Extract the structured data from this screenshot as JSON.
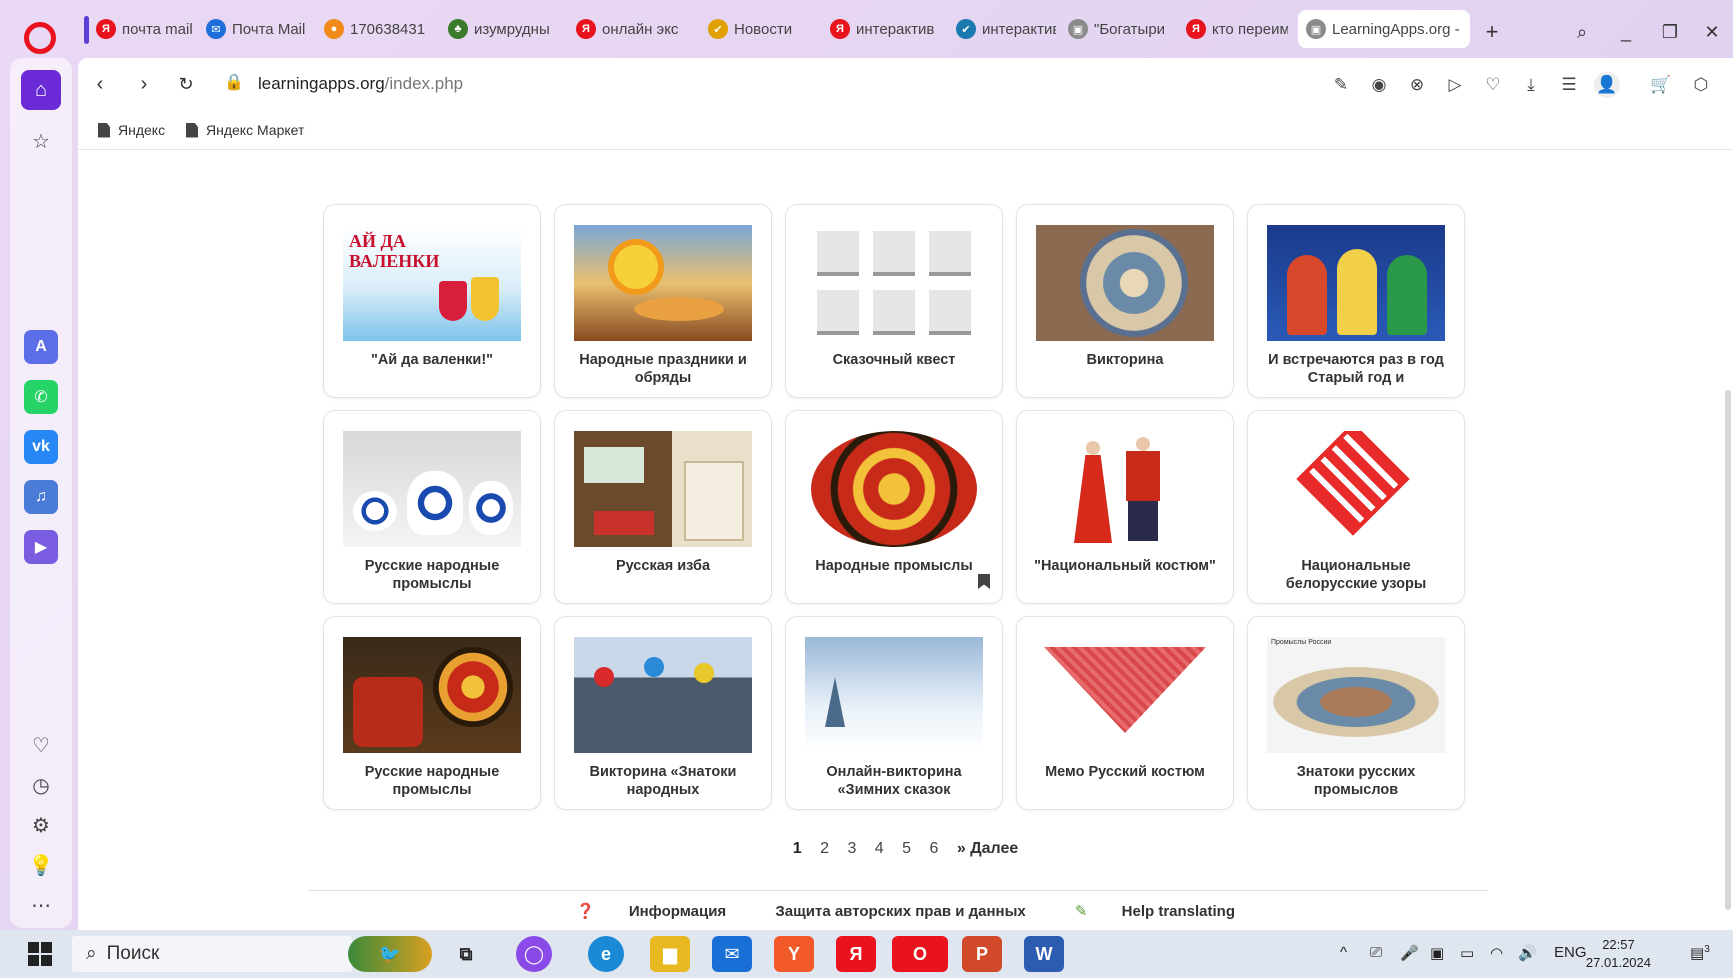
{
  "tabs": [
    {
      "label": "почта mail",
      "fav": "Я",
      "color": "#e8131d"
    },
    {
      "label": "Почта Mail",
      "fav": "✉",
      "color": "#1e6fd9"
    },
    {
      "label": "170638431",
      "fav": "●",
      "color": "#f28a1a"
    },
    {
      "label": "изумрудны",
      "fav": "♣",
      "color": "#3a7a2a"
    },
    {
      "label": "онлайн экс",
      "fav": "Я",
      "color": "#e8131d"
    },
    {
      "label": "Новости",
      "fav": "✔",
      "color": "#e0a000"
    },
    {
      "label": "интерактив",
      "fav": "Я",
      "color": "#e8131d"
    },
    {
      "label": "интерактив",
      "fav": "✔",
      "color": "#1a7ab0"
    },
    {
      "label": "\"Богатыри",
      "fav": "▣",
      "color": "#8a8a8a"
    },
    {
      "label": "кто переим",
      "fav": "Я",
      "color": "#e8131d"
    },
    {
      "label": "LearningApps.org -",
      "fav": "▣",
      "color": "#8a8a8a"
    }
  ],
  "address": {
    "host": "learningapps.org",
    "path": "/index.php"
  },
  "bookmarks": [
    "Яндекс",
    "Яндекс Маркет"
  ],
  "cards": [
    {
      "title": "\"Ай да валенки!\"",
      "thumb": "valenki",
      "thumb_text": "АЙ ДА ВАЛЕНКИ"
    },
    {
      "title": "Народные праздники и обряды",
      "thumb": "prazdniki"
    },
    {
      "title": "Сказочный квест",
      "thumb": "kvest"
    },
    {
      "title": "Викторина",
      "thumb": "viktorina"
    },
    {
      "title": "И встречаются раз в год Старый год и",
      "thumb": "staryi"
    },
    {
      "title": "Русские народные промыслы",
      "thumb": "gzhel"
    },
    {
      "title": "Русская изба",
      "thumb": "izba"
    },
    {
      "title": "Народные промыслы",
      "thumb": "khokhloma"
    },
    {
      "title": "\"Национальный костюм\"",
      "thumb": "kostum"
    },
    {
      "title": "Национальные белорусские узоры",
      "thumb": "uzory"
    },
    {
      "title": "Русские народные промыслы",
      "thumb": "promysly2"
    },
    {
      "title": "Викторина «Знатоки народных",
      "thumb": "znatoki"
    },
    {
      "title": "Онлайн-викторина «Зимних сказок",
      "thumb": "zima"
    },
    {
      "title": "Мемо Русский костюм",
      "thumb": "platok"
    },
    {
      "title": "Знатоки русских промыслов",
      "thumb": "map",
      "thumb_text": "Промыслы России"
    }
  ],
  "pager": {
    "pages": [
      "1",
      "2",
      "3",
      "4",
      "5",
      "6"
    ],
    "next": "» Далее"
  },
  "footer": {
    "info": "Информация",
    "rights": "Защита авторских прав и данных",
    "translate": "Help translating"
  },
  "taskbar": {
    "search": "Поиск",
    "lang": "ENG",
    "time": "22:57",
    "date": "27.01.2024",
    "notif": "3"
  },
  "colors": {
    "opera_red": "#e8131d",
    "opera_purple": "#6a2bd6"
  }
}
